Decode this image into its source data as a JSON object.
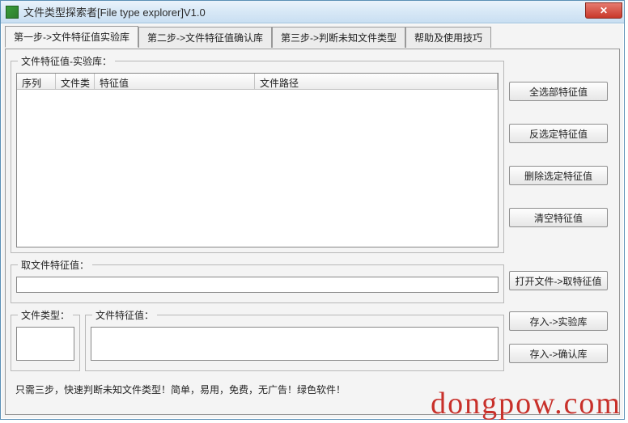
{
  "window": {
    "title": "文件类型探索者[File type explorer]V1.0"
  },
  "tabs": [
    {
      "label": "第一步->文件特征值实验库"
    },
    {
      "label": "第二步->文件特征值确认库"
    },
    {
      "label": "第三步->判断未知文件类型"
    },
    {
      "label": "帮助及使用技巧"
    }
  ],
  "group_labels": {
    "feature_lib": "文件特征值-实验库：",
    "get_value": "取文件特征值：",
    "file_type": "文件类型：",
    "file_feature": "文件特征值："
  },
  "table": {
    "columns": [
      "序列",
      "文件类",
      "特征值",
      "文件路径"
    ],
    "rows": []
  },
  "buttons": {
    "select_all": "全选部特征值",
    "invert_select": "反选定特征值",
    "delete_selected": "删除选定特征值",
    "clear": "清空特征值",
    "open_file": "打开文件->取特征值",
    "save_lib": "存入->实验库",
    "save_confirm": "存入->确认库"
  },
  "footer": "只需三步，快速判断未知文件类型！简单，易用，免费，无广告！绿色软件！",
  "watermark": "dongpow.com"
}
